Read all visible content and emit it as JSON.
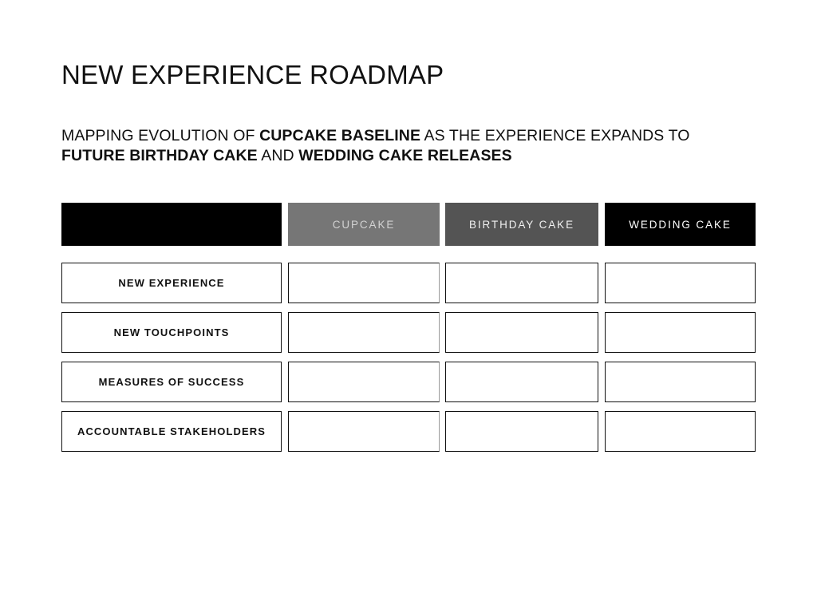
{
  "slide": {
    "title": "NEW EXPERIENCE ROADMAP",
    "subtitle": {
      "line1_part1": "MAPPING EVOLUTION OF ",
      "line1_bold1": "CUPCAKE BASELINE",
      "line1_part2": " AS THE EXPERIENCE EXPANDS TO",
      "line2_bold1": "FUTURE BIRTHDAY CAKE",
      "line2_part1": " AND ",
      "line2_bold2": "WEDDING CAKE RELEASES"
    }
  },
  "matrix": {
    "corner_label": "",
    "columns": [
      {
        "label": "CUPCAKE",
        "bg": "#767676",
        "fg": "#d2d2d2"
      },
      {
        "label": "BIRTHDAY CAKE",
        "bg": "#545454",
        "fg": "#f1f1f1"
      },
      {
        "label": "WEDDING CAKE",
        "bg": "#000000",
        "fg": "#ffffff"
      }
    ],
    "rows": [
      {
        "label": "NEW EXPERIENCE",
        "cells": [
          "",
          "",
          ""
        ]
      },
      {
        "label": "NEW TOUCHPOINTS",
        "cells": [
          "",
          "",
          ""
        ]
      },
      {
        "label": "MEASURES OF SUCCESS",
        "cells": [
          "",
          "",
          ""
        ]
      },
      {
        "label": "ACCOUNTABLE STAKEHOLDERS",
        "cells": [
          "",
          "",
          ""
        ]
      }
    ]
  },
  "colors": {
    "background": "#ffffff",
    "text": "#111111",
    "border": "#111111",
    "cupcake_border_right": "#9a9a9a",
    "header_black": "#000000",
    "header_mid_gray": "#767676",
    "header_dark_gray": "#545454"
  }
}
